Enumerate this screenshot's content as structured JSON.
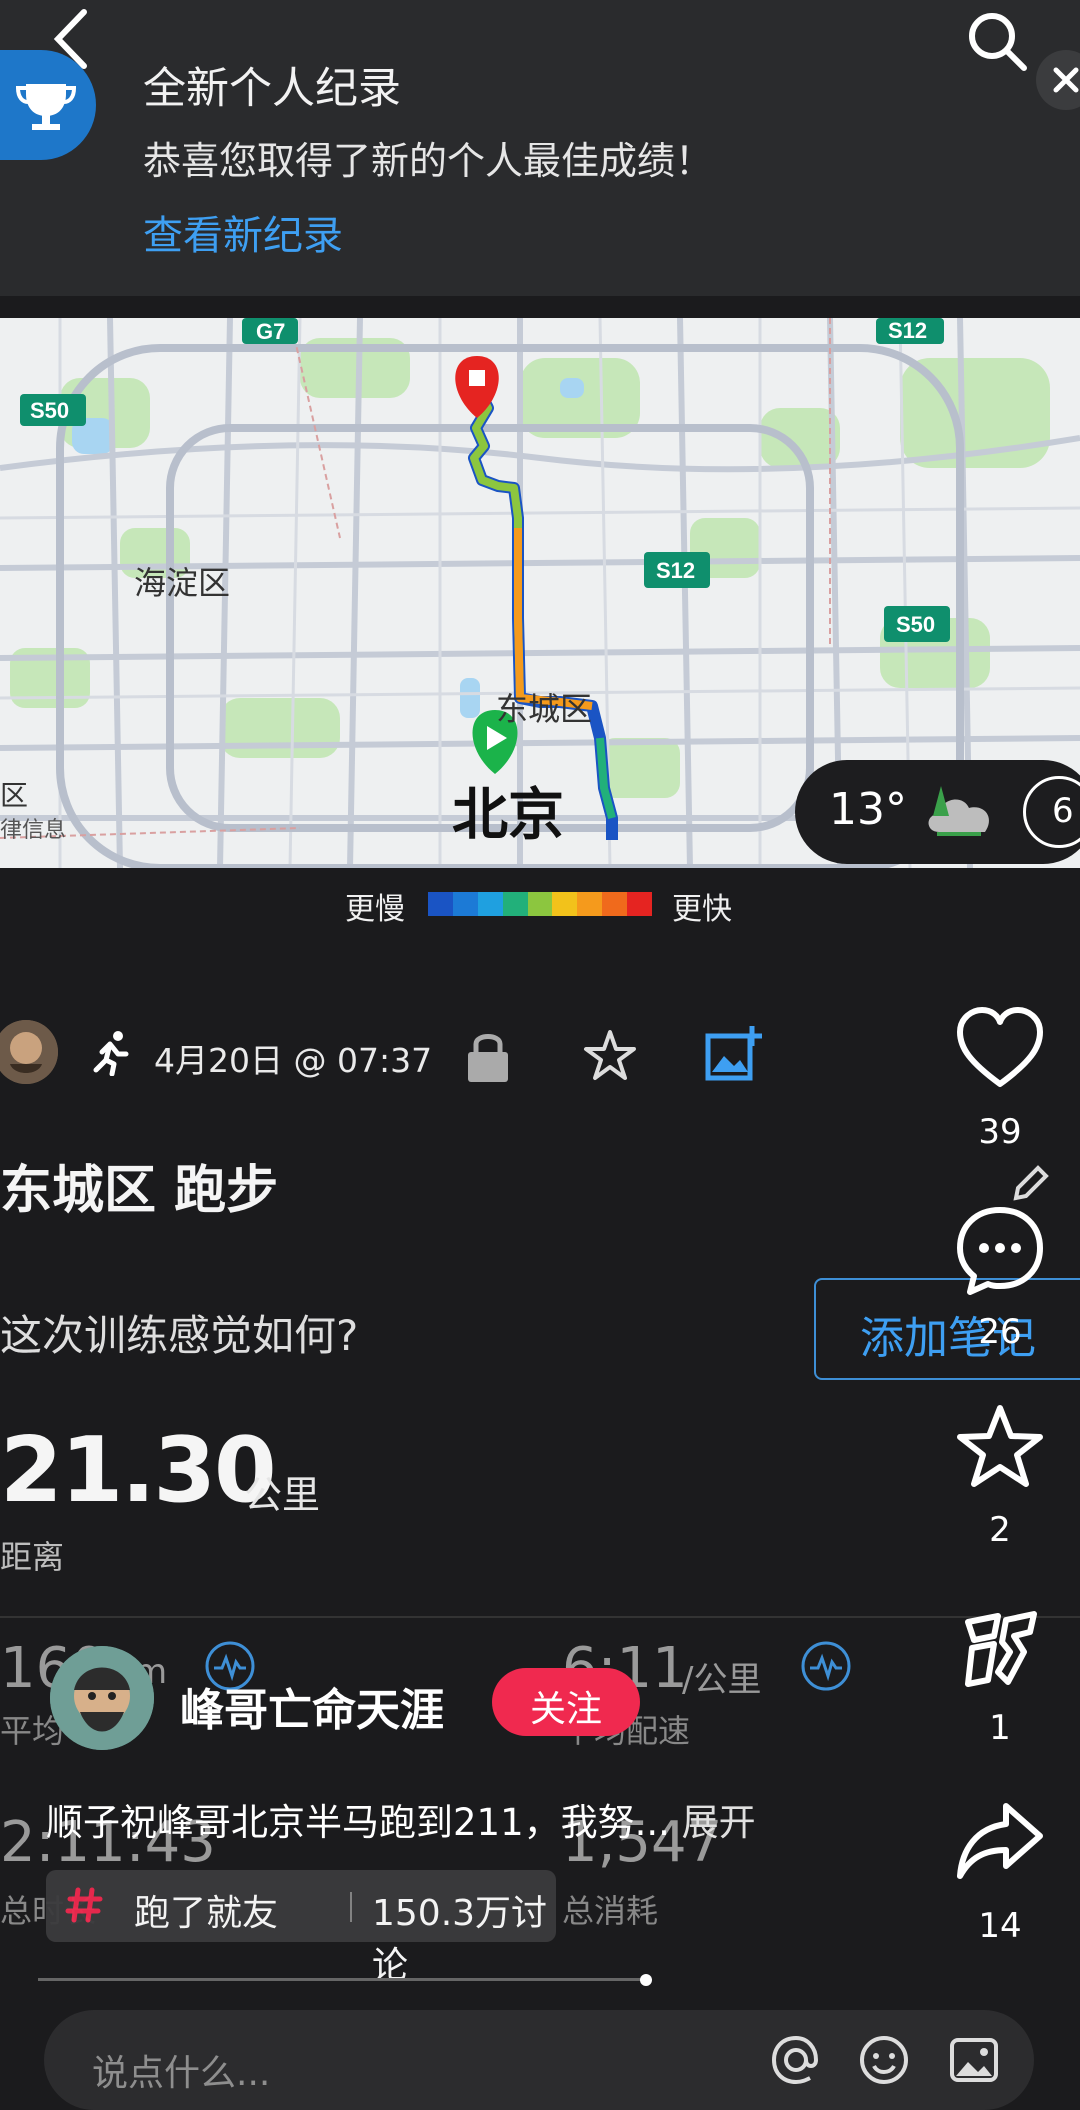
{
  "notification": {
    "title": "全新个人纪录",
    "message": "恭喜您取得了新的个人最佳成绩！",
    "link": "查看新纪录"
  },
  "map": {
    "labels": {
      "haidian": "海淀区",
      "dongcheng": "东城区",
      "beijing": "北京",
      "left_district": "区",
      "left_info": "律信息"
    },
    "road_shields": [
      "G7",
      "S12",
      "S50",
      "S12",
      "S50"
    ],
    "weather": {
      "temperature": "13°",
      "extra": "6"
    }
  },
  "legend": {
    "slow": "更慢",
    "fast": "更快",
    "colors": [
      "#1a54c4",
      "#1c7ad6",
      "#1fa0e0",
      "#22b07a",
      "#8cc63f",
      "#f2c21b",
      "#f59a1c",
      "#f06a1c",
      "#e52421"
    ]
  },
  "activity": {
    "date": "4月20日 @ 07:37",
    "title": "东城区 跑步",
    "feel_question": "这次训练感觉如何?",
    "add_note": "添加笔记",
    "distance": {
      "value": "21.30",
      "unit": "公里",
      "label": "距离"
    },
    "stats": [
      {
        "value": "160",
        "unit": "m",
        "label": "平均"
      },
      {
        "value": "6:11",
        "unit": "/公里",
        "label": "平均配速"
      },
      {
        "value": "2:11:43",
        "unit": "",
        "label": "总时长"
      },
      {
        "value": "1,547",
        "unit": "",
        "label": "总消耗"
      }
    ]
  },
  "post": {
    "author": "峰哥亡命天涯",
    "follow": "关注",
    "caption": "顺子祝峰哥北京半马跑到211，我努...",
    "expand": "展开",
    "topic": {
      "name": "跑了就友",
      "count": "150.3万讨论"
    }
  },
  "rail": {
    "likes": "39",
    "comments": "26",
    "favorites": "2",
    "good": "1",
    "shares": "14"
  },
  "input": {
    "placeholder": "说点什么..."
  },
  "colors": {
    "accent_blue": "#3e9ff2",
    "follow_red": "#f0294f",
    "trophy_blue": "#1e77c9"
  }
}
